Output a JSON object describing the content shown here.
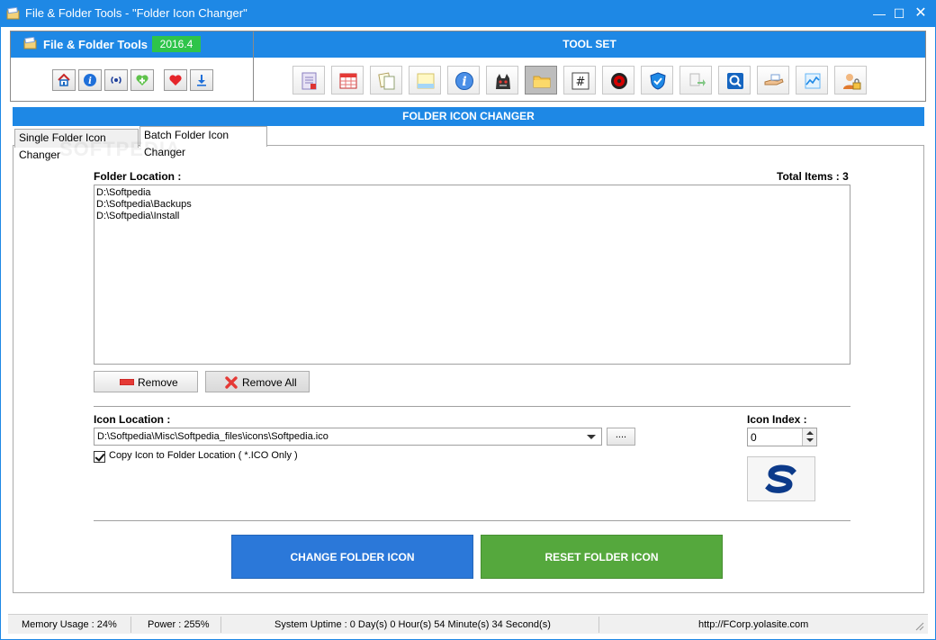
{
  "window": {
    "title": "File & Folder Tools - \"Folder Icon Changer\"",
    "minimize": "—",
    "maximize": "☐",
    "close": "✕"
  },
  "brand": {
    "name": "File & Folder Tools",
    "version": "2016.4"
  },
  "toolset": {
    "title": "TOOL SET",
    "tools": [
      {
        "name": "document-list-icon"
      },
      {
        "name": "calendar-grid-icon"
      },
      {
        "name": "copy-files-icon"
      },
      {
        "name": "notepad-icon"
      },
      {
        "name": "info-icon"
      },
      {
        "name": "monster-icon"
      },
      {
        "name": "folder-icon",
        "active": true
      },
      {
        "name": "hash-icon"
      },
      {
        "name": "gear-red-icon"
      },
      {
        "name": "shield-icon"
      },
      {
        "name": "rename-icon"
      },
      {
        "name": "search-icon"
      },
      {
        "name": "hand-file-icon"
      },
      {
        "name": "chart-icon"
      },
      {
        "name": "user-lock-icon"
      }
    ]
  },
  "small_buttons": [
    {
      "name": "home-icon"
    },
    {
      "name": "info-icon"
    },
    {
      "name": "broadcast-icon"
    },
    {
      "name": "plus-heart-icon"
    },
    {
      "name": "heart-icon"
    },
    {
      "name": "download-icon"
    }
  ],
  "section": {
    "title": "FOLDER ICON CHANGER"
  },
  "tabs": [
    {
      "label": "Single Folder Icon Changer",
      "active": false
    },
    {
      "label": "Batch Folder Icon Changer",
      "active": true
    }
  ],
  "folder_location": {
    "label": "Folder Location :",
    "total_items": "Total Items : 3",
    "items": [
      "D:\\Softpedia",
      "D:\\Softpedia\\Backups",
      "D:\\Softpedia\\Install"
    ]
  },
  "buttons": {
    "remove": "Remove",
    "remove_all": "Remove All",
    "browse": "....",
    "change": "CHANGE FOLDER ICON",
    "reset": "RESET FOLDER ICON"
  },
  "icon_location": {
    "label": "Icon Location :",
    "value": "D:\\Softpedia\\Misc\\Softpedia_files\\icons\\Softpedia.ico",
    "copy_label": "Copy Icon to Folder Location ( *.ICO Only )",
    "copy_checked": true
  },
  "icon_index": {
    "label": "Icon Index :",
    "value": "0"
  },
  "status": {
    "memory": "Memory Usage : 24%",
    "power": "Power : 255%",
    "uptime": "System Uptime : 0 Day(s) 0 Hour(s) 54 Minute(s) 34 Second(s)",
    "url": "http://FCorp.yolasite.com"
  },
  "watermark": "SOFTPEDIA",
  "colors": {
    "accent": "#1e88e5",
    "version_badge": "#2ec44a",
    "change_button": "#2b78d9",
    "reset_button": "#55a83d"
  }
}
